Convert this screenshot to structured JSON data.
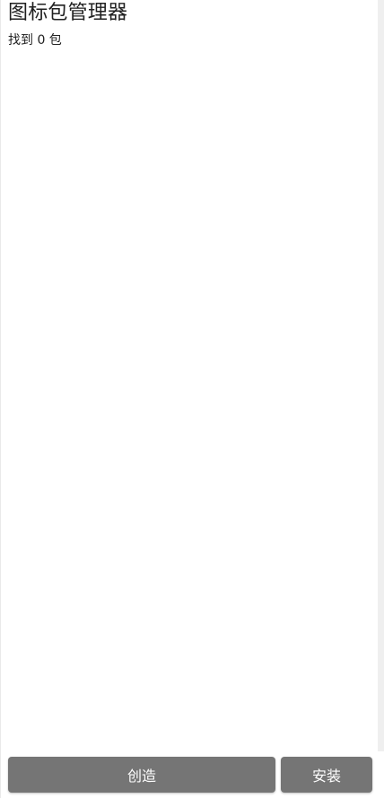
{
  "header": {
    "title": "图标包管理器",
    "count_label": "找到 0 包"
  },
  "bottom_bar": {
    "create_label": "创造",
    "install_label": "安装"
  },
  "colors": {
    "button_bg": "#757575",
    "button_text": "#ffffff",
    "title_text": "#202020"
  }
}
